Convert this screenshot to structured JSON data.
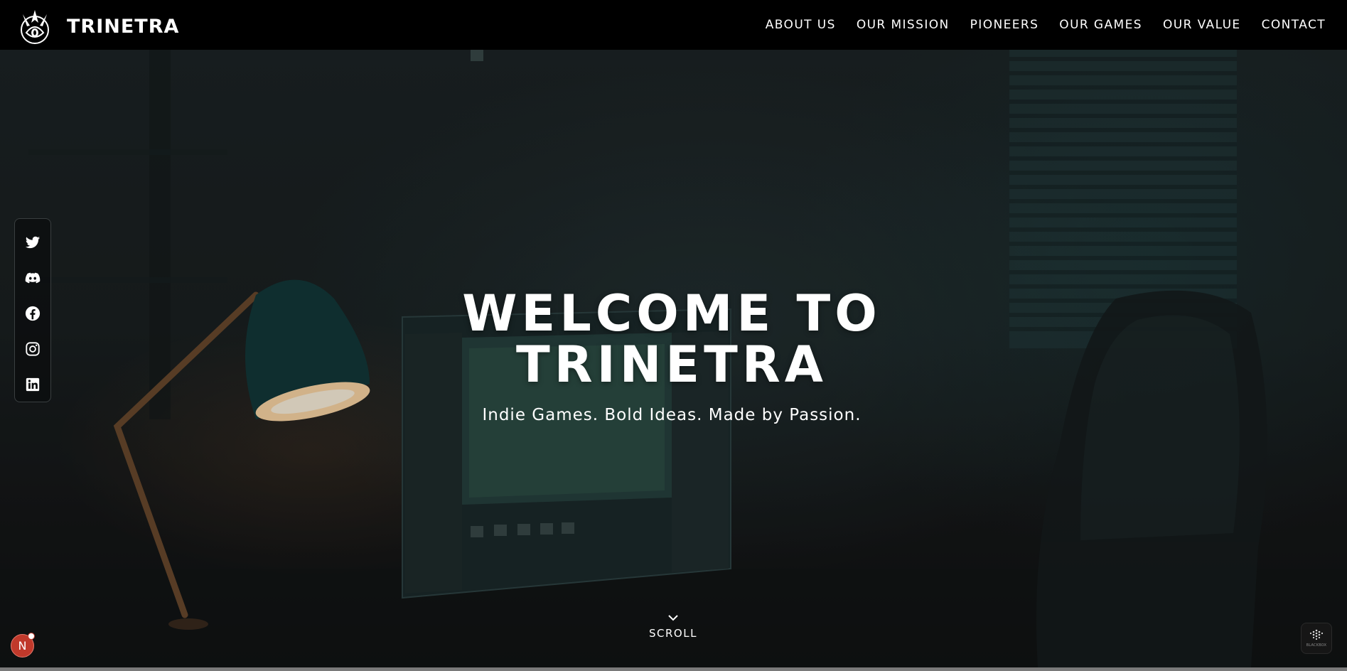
{
  "brand": {
    "name": "TRINETRA",
    "logo_icon": "trinetra-logo-icon"
  },
  "nav": {
    "links": [
      {
        "label": "ABOUT US"
      },
      {
        "label": "OUR MISSION"
      },
      {
        "label": "PIONEERS"
      },
      {
        "label": "OUR GAMES"
      },
      {
        "label": "OUR VALUE"
      },
      {
        "label": "CONTACT"
      }
    ]
  },
  "social": {
    "icons": [
      "twitter-icon",
      "discord-icon",
      "facebook-icon",
      "instagram-icon",
      "linkedin-icon"
    ]
  },
  "hero": {
    "title_line1": "WELCOME TO",
    "title_line2": "TRINETRA",
    "subtitle": "Indie Games. Bold Ideas. Made by Passion."
  },
  "scroll": {
    "label": "SCROLL",
    "icon": "chevron-down-icon"
  },
  "widgets": {
    "notification_letter": "N",
    "blackbox_label": "BLACKBOX"
  },
  "colors": {
    "nav_bg": "#000000",
    "text": "#ffffff",
    "hero_teal": "#1e3a3c",
    "lamp_glow": "#ffd9a8",
    "notification_red": "#c0392b"
  }
}
